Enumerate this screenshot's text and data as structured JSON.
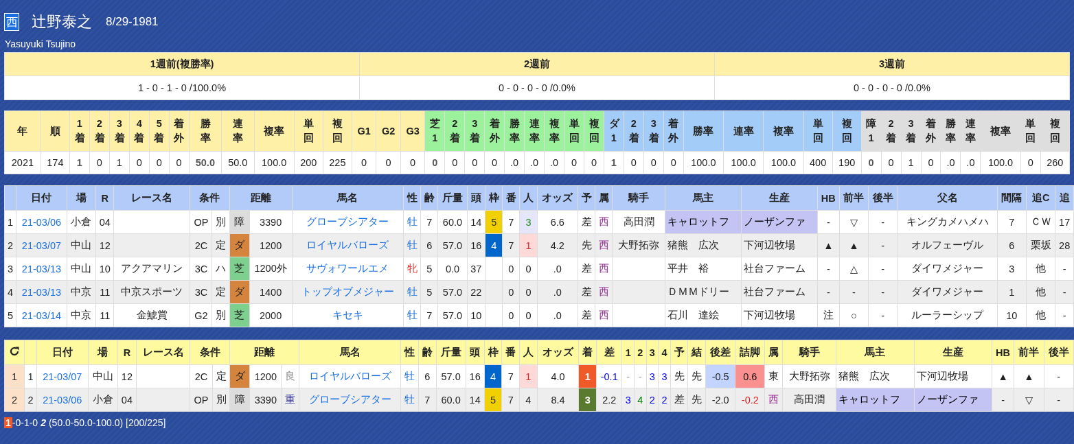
{
  "jockey": {
    "region": "西",
    "name": "辻野泰之",
    "birth": "8/29-1981",
    "romaji": "Yasuyuki Tsujino"
  },
  "weekly": [
    {
      "label": "1週前(複勝率)",
      "value": "1 - 0 - 1 - 0 /100.0%"
    },
    {
      "label": "2週前",
      "value": "0 - 0 - 0 - 0 /0.0%"
    },
    {
      "label": "3週前",
      "value": "0 - 0 - 0 - 0 /0.0%"
    }
  ],
  "stats": [
    {
      "label": "年",
      "kind": "all",
      "value": "2021"
    },
    {
      "label": "順",
      "kind": "all",
      "value": "174"
    },
    {
      "label": "1着",
      "kind": "all",
      "value": "1",
      "bold": true
    },
    {
      "label": "2着",
      "kind": "all",
      "value": "0"
    },
    {
      "label": "3着",
      "kind": "all",
      "value": "1"
    },
    {
      "label": "4着",
      "kind": "all",
      "value": "0"
    },
    {
      "label": "5着",
      "kind": "all",
      "value": "0"
    },
    {
      "label": "着外",
      "kind": "all",
      "value": "0"
    },
    {
      "label": "勝率",
      "kind": "all",
      "value": "50.0",
      "bold": true
    },
    {
      "label": "連率",
      "kind": "all",
      "value": "50.0"
    },
    {
      "label": "複率",
      "kind": "all",
      "value": "100.0"
    },
    {
      "label": "単回",
      "kind": "all",
      "value": "200"
    },
    {
      "label": "複回",
      "kind": "all",
      "value": "225"
    },
    {
      "label": "G1",
      "kind": "all",
      "value": "0"
    },
    {
      "label": "G2",
      "kind": "all",
      "value": "0"
    },
    {
      "label": "G3",
      "kind": "all",
      "value": "0"
    },
    {
      "label": "芝1",
      "kind": "turf",
      "value": "0",
      "bold": true
    },
    {
      "label": "2着",
      "kind": "turf",
      "value": "0"
    },
    {
      "label": "3着",
      "kind": "turf",
      "value": "0"
    },
    {
      "label": "着外",
      "kind": "turf",
      "value": "0"
    },
    {
      "label": "勝率",
      "kind": "turf",
      "value": ".0"
    },
    {
      "label": "連率",
      "kind": "turf",
      "value": ".0"
    },
    {
      "label": "複率",
      "kind": "turf",
      "value": ".0"
    },
    {
      "label": "単回",
      "kind": "turf",
      "value": "0"
    },
    {
      "label": "複回",
      "kind": "turf",
      "value": "0"
    },
    {
      "label": "ダ1",
      "kind": "dirt",
      "value": "1",
      "bold": true
    },
    {
      "label": "2着",
      "kind": "dirt",
      "value": "0"
    },
    {
      "label": "3着",
      "kind": "dirt",
      "value": "0"
    },
    {
      "label": "着外",
      "kind": "dirt",
      "value": "0"
    },
    {
      "label": "勝率",
      "kind": "dirt",
      "value": "100.0"
    },
    {
      "label": "連率",
      "kind": "dirt",
      "value": "100.0"
    },
    {
      "label": "複率",
      "kind": "dirt",
      "value": "100.0"
    },
    {
      "label": "単回",
      "kind": "dirt",
      "value": "400"
    },
    {
      "label": "複回",
      "kind": "dirt",
      "value": "190"
    },
    {
      "label": "障1",
      "kind": "jump",
      "value": "0",
      "bold": true
    },
    {
      "label": "2着",
      "kind": "jump",
      "value": "0"
    },
    {
      "label": "3着",
      "kind": "jump",
      "value": "1"
    },
    {
      "label": "着外",
      "kind": "jump",
      "value": "0"
    },
    {
      "label": "勝率",
      "kind": "jump",
      "value": ".0"
    },
    {
      "label": "連率",
      "kind": "jump",
      "value": ".0"
    },
    {
      "label": "複率",
      "kind": "jump",
      "value": "100.0"
    },
    {
      "label": "単回",
      "kind": "jump",
      "value": "0"
    },
    {
      "label": "複回",
      "kind": "jump",
      "value": "260"
    }
  ],
  "races": {
    "headers": [
      "日付",
      "場",
      "R",
      "レース名",
      "条件",
      "距離",
      "馬名",
      "性",
      "齢",
      "斤量",
      "頭",
      "枠",
      "番",
      "人",
      "オッズ",
      "予",
      "属",
      "騎手",
      "馬主",
      "生産",
      "HB",
      "前半",
      "後半",
      "父名",
      "間隔",
      "追C",
      "追"
    ],
    "rows": [
      {
        "no": "1",
        "date": "21-03/06",
        "place": "小倉",
        "r": "04",
        "grade": "OP",
        "cond": "別",
        "surface": {
          "label": "障",
          "kind": "jump"
        },
        "dist": "3390",
        "horse": "グローブシアター",
        "sex": {
          "label": "牡",
          "kind": "male"
        },
        "age": "7",
        "weight": "60.0",
        "heads": "14",
        "waku": {
          "label": "5",
          "color": "#f0d000"
        },
        "ban": "7",
        "pop": {
          "label": "3",
          "kind": "third"
        },
        "odds": "6.6",
        "style": "差",
        "region": {
          "label": "西",
          "kind": "west"
        },
        "jockey": "高田潤",
        "owner": {
          "label": "キャロットフ",
          "highlighted": true
        },
        "breeder": {
          "label": "ノーザンファ",
          "highlighted": true
        },
        "hb": "-",
        "first": "▽",
        "second": "-",
        "sire": "キングカメハメハ",
        "interval": "7",
        "course": "ＣＷ",
        "extra": "17"
      },
      {
        "no": "2",
        "date": "21-03/07",
        "place": "中山",
        "r": "12",
        "grade": "2C",
        "cond": "定",
        "surface": {
          "label": "ダ",
          "kind": "dirt"
        },
        "dist": "1200",
        "horse": "ロイヤルバローズ",
        "sex": {
          "label": "牡",
          "kind": "male"
        },
        "age": "6",
        "weight": "57.0",
        "heads": "16",
        "waku": {
          "label": "4",
          "color": "#0066cc"
        },
        "ban": "7",
        "pop": {
          "label": "1",
          "kind": "first"
        },
        "odds": "4.2",
        "style": "先",
        "region": {
          "label": "西",
          "kind": "west"
        },
        "jockey": "大野拓弥",
        "owner": {
          "label": "猪熊　広次",
          "highlighted": false
        },
        "breeder": {
          "label": "下河辺牧場",
          "highlighted": false
        },
        "hb": "▲",
        "first": "▲",
        "second": "-",
        "sire": "オルフェーヴル",
        "interval": "6",
        "course": "栗坂",
        "extra": "28"
      },
      {
        "no": "3",
        "date": "21-03/13",
        "place": "中山",
        "r": "10",
        "race": "アクアマリン",
        "grade": "3C",
        "cond": "ハ",
        "surface": {
          "label": "芝",
          "kind": "turf"
        },
        "dist": "1200外",
        "horse": "サヴォワールエメ",
        "sex": {
          "label": "牝",
          "kind": "female"
        },
        "age": "5",
        "weight": "0.0",
        "heads": "37",
        "ban": "0",
        "pop": {
          "label": "0",
          "kind": "plain"
        },
        "odds": ".0",
        "style": "差",
        "region": {
          "label": "西",
          "kind": "west"
        },
        "owner": {
          "label": "平井　裕",
          "highlighted": false
        },
        "breeder": {
          "label": "社台ファーム",
          "highlighted": false
        },
        "hb": "-",
        "first": "△",
        "second": "-",
        "sire": "ダイワメジャー",
        "interval": "3",
        "course": "他",
        "extra": "-"
      },
      {
        "no": "4",
        "date": "21-03/13",
        "place": "中京",
        "r": "11",
        "race": "中京スポーツ",
        "grade": "3C",
        "cond": "定",
        "surface": {
          "label": "ダ",
          "kind": "dirt"
        },
        "dist": "1400",
        "horse": "トップオブメジャー",
        "sex": {
          "label": "牡",
          "kind": "male"
        },
        "age": "5",
        "weight": "57.0",
        "heads": "22",
        "ban": "0",
        "pop": {
          "label": "0",
          "kind": "plain"
        },
        "odds": ".0",
        "style": "差",
        "region": {
          "label": "西",
          "kind": "west"
        },
        "owner": {
          "label": "ＤＭＭドリー",
          "highlighted": false
        },
        "breeder": {
          "label": "社台ファーム",
          "highlighted": false
        },
        "hb": "-",
        "first": "-",
        "second": "-",
        "sire": "ダイワメジャー",
        "interval": "1",
        "course": "他",
        "extra": "-"
      },
      {
        "no": "5",
        "date": "21-03/14",
        "place": "中京",
        "r": "11",
        "race": "金鯱賞",
        "grade": "G2",
        "cond": "別",
        "surface": {
          "label": "芝",
          "kind": "turf"
        },
        "dist": "2000",
        "horse": "キセキ",
        "sex": {
          "label": "牡",
          "kind": "male"
        },
        "age": "7",
        "weight": "57.0",
        "heads": "10",
        "ban": "0",
        "pop": {
          "label": "0",
          "kind": "plain"
        },
        "odds": ".0",
        "style": "差",
        "region": {
          "label": "西",
          "kind": "west"
        },
        "owner": {
          "label": "石川　達絵",
          "highlighted": false
        },
        "breeder": {
          "label": "下河辺牧場",
          "highlighted": false
        },
        "hb": "注",
        "first": "○",
        "second": "-",
        "sire": "ルーラーシップ",
        "interval": "10",
        "course": "他",
        "extra": "-"
      }
    ]
  },
  "history": {
    "headers": [
      "日付",
      "場",
      "R",
      "レース名",
      "条件",
      "距離",
      "馬名",
      "性",
      "齢",
      "斤量",
      "頭",
      "枠",
      "番",
      "人",
      "オッズ",
      "着",
      "差",
      "1",
      "2",
      "3",
      "4",
      "予",
      "結",
      "後差",
      "詰脚",
      "属",
      "騎手",
      "馬主",
      "生産",
      "HB",
      "前半",
      "後半"
    ],
    "rows": [
      {
        "idx": "1",
        "no": "1",
        "date": "21-03/07",
        "place": "中山",
        "r": "12",
        "grade": "2C",
        "cond": "定",
        "surface": {
          "label": "ダ",
          "kind": "dirt"
        },
        "dist": "1200",
        "going": {
          "label": "良",
          "kind": "good"
        },
        "horse": "ロイヤルバローズ",
        "sex": {
          "label": "牡",
          "kind": "male"
        },
        "age": "6",
        "weight": "57.0",
        "heads": "16",
        "waku": {
          "label": "4",
          "color": "#0066cc"
        },
        "ban": "7",
        "pop": {
          "label": "1",
          "kind": "first"
        },
        "odds": "4.0",
        "finish": {
          "label": "1",
          "color": "#f05a28"
        },
        "margin": {
          "label": "-0.1",
          "color": "#0000ee"
        },
        "c1": {
          "label": "-",
          "color": "#999999"
        },
        "c2": {
          "label": "-",
          "color": "#999999"
        },
        "c3": {
          "label": "3",
          "color": "#0000ee"
        },
        "c4": {
          "label": "3",
          "color": "#0000ee"
        },
        "style": "先",
        "result": "先",
        "late": {
          "label": "-0.5",
          "highlighted": true
        },
        "spurt": {
          "label": "0.6",
          "kind": "strong"
        },
        "region": {
          "label": "東",
          "kind": "east"
        },
        "jockey": "大野拓弥",
        "owner": {
          "label": "猪熊　広次",
          "highlighted": false
        },
        "breeder": {
          "label": "下河辺牧場",
          "highlighted": false
        },
        "hb": "▲",
        "first": "▲",
        "second": "-"
      },
      {
        "idx": "2",
        "no": "2",
        "date": "21-03/06",
        "place": "小倉",
        "r": "04",
        "grade": "OP",
        "cond": "別",
        "surface": {
          "label": "障",
          "kind": "jump"
        },
        "dist": "3390",
        "going": {
          "label": "重",
          "kind": "heavy"
        },
        "horse": "グローブシアター",
        "sex": {
          "label": "牡",
          "kind": "male"
        },
        "age": "7",
        "weight": "60.0",
        "heads": "14",
        "waku": {
          "label": "5",
          "color": "#f0d000"
        },
        "ban": "7",
        "pop": {
          "label": "4",
          "kind": "plain"
        },
        "odds": "8.4",
        "finish": {
          "label": "3",
          "color": "#5a7a30"
        },
        "margin": {
          "label": "2.2",
          "color": "#222222"
        },
        "c1": {
          "label": "3",
          "color": "#0000ee"
        },
        "c2": {
          "label": "4",
          "color": "#008000"
        },
        "c3": {
          "label": "2",
          "color": "#0000ee"
        },
        "c4": {
          "label": "2",
          "color": "#0000ee"
        },
        "style": "差",
        "result": "先",
        "late": {
          "label": "-2.0",
          "highlighted": false
        },
        "spurt": {
          "label": "-0.2",
          "kind": "weak"
        },
        "region": {
          "label": "西",
          "kind": "west"
        },
        "jockey": "高田潤",
        "owner": {
          "label": "キャロットフ",
          "highlighted": true
        },
        "breeder": {
          "label": "ノーザンファ",
          "highlighted": true
        },
        "hb": "-",
        "first": "▽",
        "second": "-"
      }
    ]
  },
  "footer": {
    "wins": "1",
    "record": "-0-1-0",
    "count": "2",
    "rates": "(50.0-50.0-100.0) [200/225]"
  }
}
